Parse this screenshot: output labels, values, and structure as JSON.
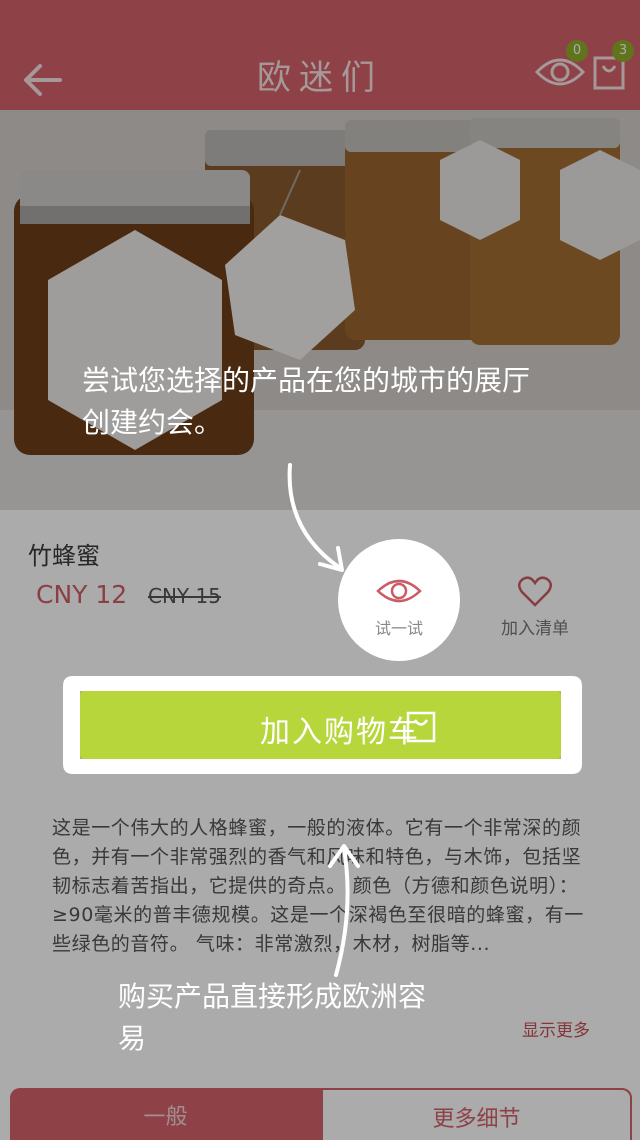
{
  "header": {
    "title": "欧迷们",
    "eye_count": "0",
    "cart_count": "3"
  },
  "product": {
    "name": "竹蜂蜜",
    "price": "CNY 12",
    "old_price": "CNY 15",
    "try_label": "试一试",
    "wishlist_label": "加入清单",
    "add_to_cart": "加入购物车",
    "description": "这是一个伟大的人格蜂蜜，一般的液体。它有一个非常深的颜色，并有一个非常强烈的香气和风味和特色，与木饰，包括坚韧标志着苦指出，它提供的奇点。 颜色（方德和颜色说明）： ≥90毫米的普丰德规模。这是一个深褐色至很暗的蜂蜜，有一些绿色的音符。 气味：非常激烈，木材，树脂等...",
    "show_more": "显示更多"
  },
  "tabs": [
    {
      "label": "一般"
    },
    {
      "label": "更多细节"
    }
  ],
  "tips": {
    "try_tip": "尝试您选择的产品在您的城市的展厅创建约会。",
    "cart_tip": "购买产品直接形成欧洲容易"
  },
  "colors": {
    "header": "#d4636b",
    "accent": "#cf5e67",
    "cart_button": "#b6d63b",
    "badge": "#8fae2b"
  },
  "icons": {
    "back": "back-arrow-icon",
    "eye": "eye-icon",
    "cart": "shopping-bag-icon",
    "heart": "heart-icon"
  }
}
